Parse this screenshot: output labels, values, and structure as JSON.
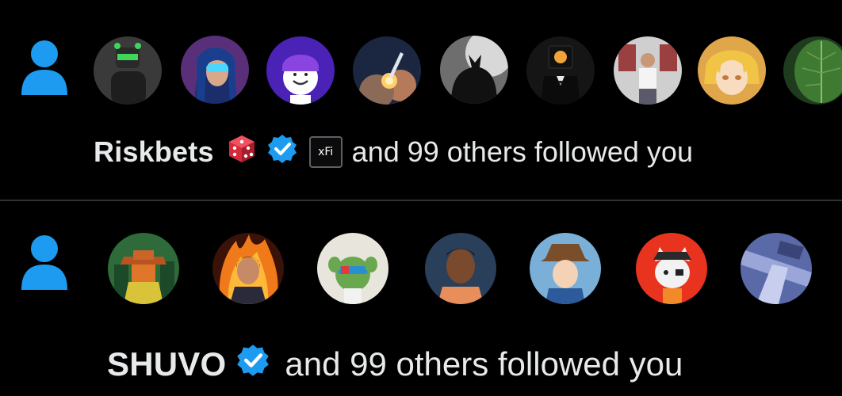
{
  "colors": {
    "accent": "#1d9bf0",
    "verified": "#1d9bf0",
    "background": "#000000",
    "divider": "#2f3336",
    "text": "#e7e9ea",
    "dice": "#d62a3a"
  },
  "notifications": [
    {
      "type": "follow",
      "icon": "person-icon",
      "avatar_count": 9,
      "name": "Riskbets",
      "emoji": "dice-icon",
      "verified": true,
      "extra_badge": "xFi",
      "message": "and 99 others followed you"
    },
    {
      "type": "follow",
      "icon": "person-icon",
      "avatar_count": 7,
      "name": "SHUVO",
      "verified": true,
      "message": "and 99 others followed you"
    }
  ]
}
